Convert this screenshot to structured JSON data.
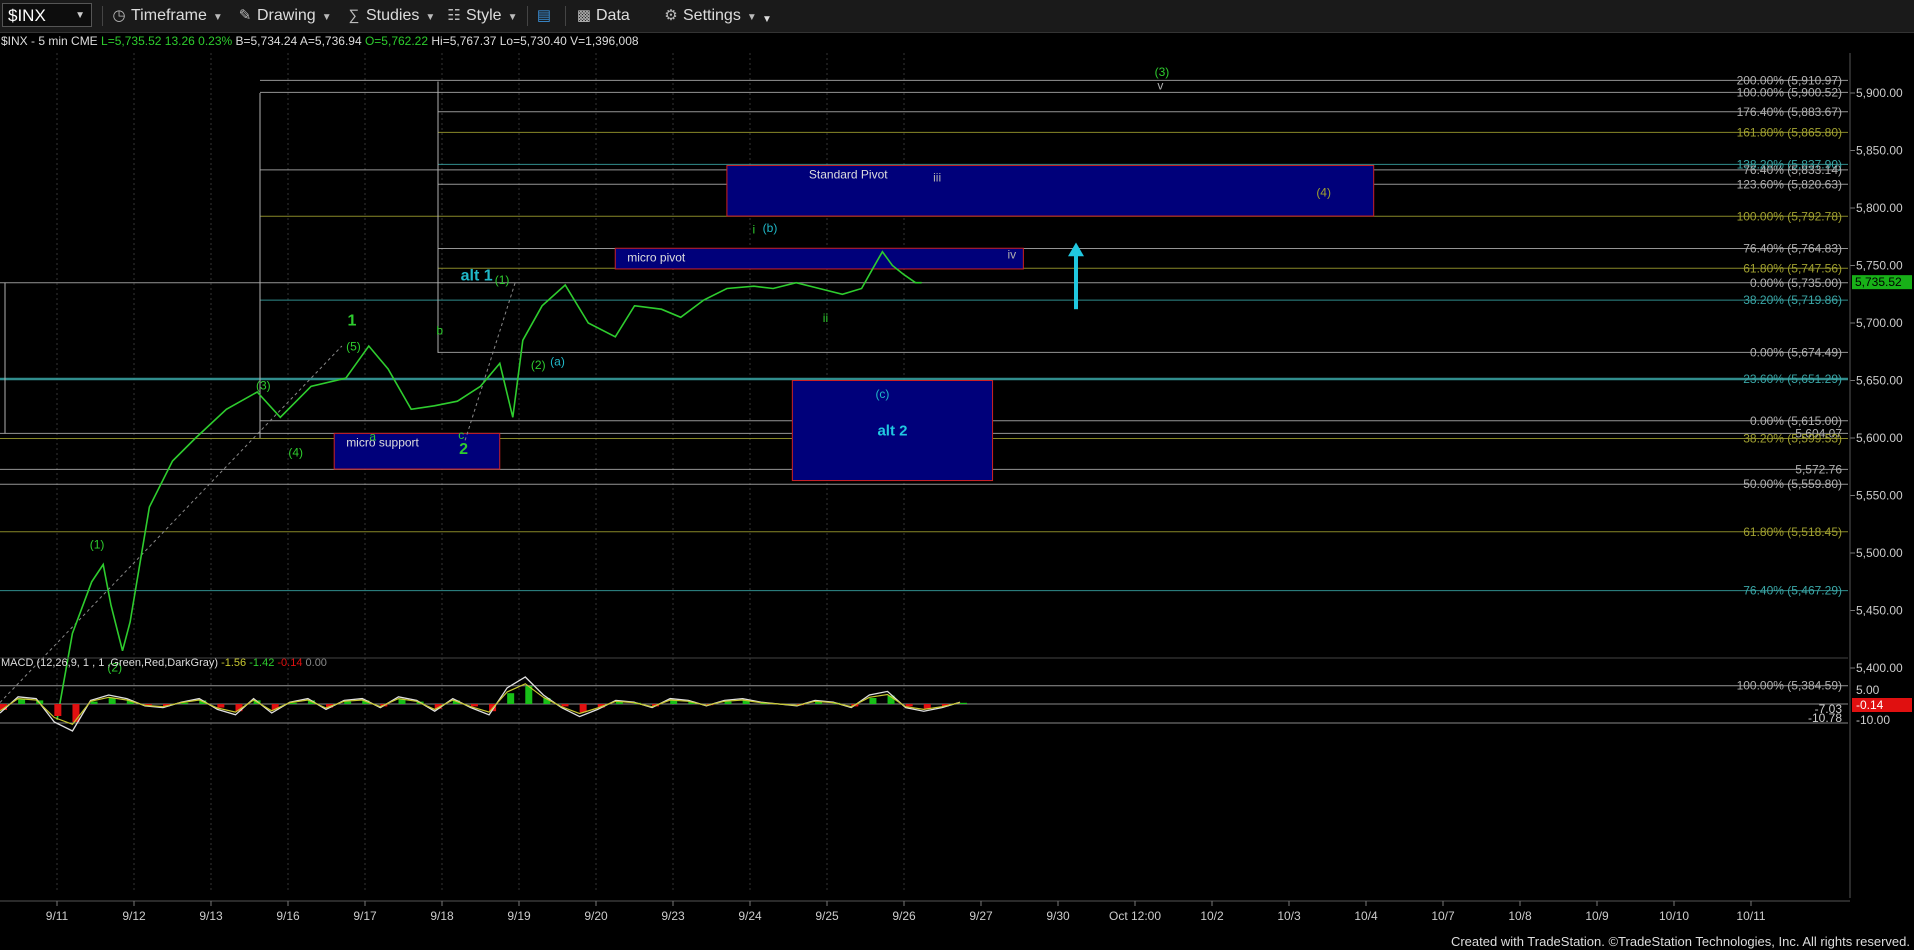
{
  "toolbar": {
    "symbol": "$INX",
    "timeframe": "Timeframe",
    "drawing": "Drawing",
    "studies": "Studies",
    "style": "Style",
    "data": "Data",
    "settings": "Settings"
  },
  "header": {
    "symbol": "$INX - 5 min",
    "exchange": "CME",
    "last": "L=5,735.52",
    "change": "13.26",
    "pct": "0.23%",
    "bid": "B=5,734.24",
    "ask": "A=5,736.94",
    "open": "O=5,762.22",
    "high": "Hi=5,767.37",
    "low": "Lo=5,730.40",
    "volume": "V=1,396,008"
  },
  "macd_header": {
    "name": "MACD (12,26,9, 1 , 1 ,Green,Red,DarkGray)",
    "v1": "-1.56",
    "v2": "-1.42",
    "v3": "-0.14",
    "v4": "0.00"
  },
  "footer": "Created with TradeStation. ©TradeStation Technologies, Inc. All rights reserved.",
  "colors": {
    "price": "#2ecc2e",
    "fib_white": "#b0b0b0",
    "fib_olive": "#a0a030",
    "fib_teal": "#3aa6a6",
    "box": "#00007a",
    "box_border": "#cc2222",
    "last_price": "#18b018",
    "macd_negative": "#e01010"
  },
  "chart_data": {
    "type": "line",
    "symbol": "$INX",
    "interval": "5 min",
    "ylim": [
      5350,
      5950
    ],
    "y_ticks": [
      "5,900.00",
      "5,850.00",
      "5,800.00",
      "5,750.00",
      "5,700.00",
      "5,650.00",
      "5,600.00",
      "5,550.00",
      "5,500.00",
      "5,450.00",
      "5,400.00"
    ],
    "x_ticks": [
      "9/11",
      "9/12",
      "9/13",
      "9/16",
      "9/17",
      "9/18",
      "9/19",
      "9/20",
      "9/23",
      "9/24",
      "9/25",
      "9/26",
      "9/27",
      "9/30",
      "Oct 12:00",
      "10/2",
      "10/3",
      "10/4",
      "10/7",
      "10/8",
      "10/9",
      "10/10",
      "10/11"
    ],
    "last_price": "5,735.52",
    "price_path": [
      [
        0,
        5355
      ],
      [
        0.2,
        5430
      ],
      [
        0.45,
        5475
      ],
      [
        0.6,
        5490
      ],
      [
        0.7,
        5455
      ],
      [
        0.85,
        5415
      ],
      [
        0.95,
        5440
      ],
      [
        1.2,
        5540
      ],
      [
        1.5,
        5580
      ],
      [
        1.8,
        5600
      ],
      [
        2.2,
        5625
      ],
      [
        2.6,
        5640
      ],
      [
        2.9,
        5618
      ],
      [
        3.3,
        5645
      ],
      [
        3.75,
        5652
      ],
      [
        4.05,
        5680
      ],
      [
        4.3,
        5660
      ],
      [
        4.6,
        5625
      ],
      [
        4.9,
        5628
      ],
      [
        5.2,
        5632
      ],
      [
        5.5,
        5645
      ],
      [
        5.75,
        5665
      ],
      [
        5.92,
        5618
      ],
      [
        6.05,
        5685
      ],
      [
        6.3,
        5715
      ],
      [
        6.6,
        5733
      ],
      [
        6.9,
        5700
      ],
      [
        7.25,
        5688
      ],
      [
        7.5,
        5715
      ],
      [
        7.85,
        5712
      ],
      [
        8.1,
        5705
      ],
      [
        8.4,
        5720
      ],
      [
        8.7,
        5730
      ],
      [
        9.05,
        5732
      ],
      [
        9.3,
        5730
      ],
      [
        9.6,
        5735
      ],
      [
        9.9,
        5730
      ],
      [
        10.2,
        5725
      ],
      [
        10.45,
        5730
      ],
      [
        10.6,
        5748
      ],
      [
        10.72,
        5762
      ],
      [
        10.85,
        5750
      ],
      [
        11.0,
        5742
      ],
      [
        11.15,
        5735
      ],
      [
        11.23,
        5735
      ]
    ],
    "macd": {
      "name": "MACD (12,26,9, 1 , 1 ,Green,Red,DarkGray)",
      "values": [
        "-1.56",
        "-1.42",
        "-0.14",
        "0.00"
      ],
      "axis_labels": [
        "5.00",
        "-0.14",
        "-7.03",
        "-10.00",
        "-10.78"
      ]
    },
    "fib_levels": [
      {
        "label": "200.00% (5,910.97)",
        "value": 5910.97,
        "color": "#b0b0b0"
      },
      {
        "label": "100.00% (5,900.52)",
        "value": 5900.52,
        "color": "#b0b0b0"
      },
      {
        "label": "176.40% (5,883.67)",
        "value": 5883.67,
        "color": "#b0b0b0"
      },
      {
        "label": "161.80% (5,865.80)",
        "value": 5865.8,
        "color": "#a0a030"
      },
      {
        "label": "138.20% (5,837.90)",
        "value": 5837.9,
        "color": "#3aa6a6"
      },
      {
        "label": "76.40% (5,833.14)",
        "value": 5833.14,
        "color": "#b0b0b0"
      },
      {
        "label": "123.60% (5,820.63)",
        "value": 5820.63,
        "color": "#b0b0b0"
      },
      {
        "label": "100.00% (5,792.78)",
        "value": 5792.78,
        "color": "#a0a030"
      },
      {
        "label": "76.40% (5,764.83)",
        "value": 5764.83,
        "color": "#b0b0b0"
      },
      {
        "label": "61.80% (5,747.56)",
        "value": 5747.56,
        "color": "#a0a030"
      },
      {
        "label": "0.00% (5,735.00)",
        "value": 5735.0,
        "color": "#b0b0b0"
      },
      {
        "label": "38.20% (5,719.86)",
        "value": 5719.86,
        "color": "#3aa6a6"
      },
      {
        "label": "0.00% (5,674.49)",
        "value": 5674.49,
        "color": "#b0b0b0"
      },
      {
        "label": "23.60% (5,651.29)",
        "value": 5651.29,
        "color": "#3aa6a6"
      },
      {
        "label": "0.00% (5,615.00)",
        "value": 5615.0,
        "color": "#b0b0b0"
      },
      {
        "label": "5,604.07",
        "value": 5604.07,
        "color": "#b0b0b0"
      },
      {
        "label": "38.20% (5,599.53)",
        "value": 5599.53,
        "color": "#a0a030"
      },
      {
        "label": "5,572.76",
        "value": 5572.76,
        "color": "#b0b0b0"
      },
      {
        "label": "50.00% (5,559.80)",
        "value": 5559.8,
        "color": "#b0b0b0"
      },
      {
        "label": "61.80% (5,518.45)",
        "value": 5518.45,
        "color": "#a0a030"
      },
      {
        "label": "76.40% (5,467.29)",
        "value": 5467.29,
        "color": "#3aa6a6"
      },
      {
        "label": "100.00% (5,384.59)",
        "value": 5384.59,
        "color": "#b0b0b0"
      }
    ],
    "boxes": [
      {
        "label": "Standard Pivot",
        "x0": 8.7,
        "x1": 17.1,
        "y0": 5793,
        "y1": 5837
      },
      {
        "label": "micro pivot",
        "x0": 7.25,
        "x1": 12.55,
        "y0": 5747,
        "y1": 5765
      },
      {
        "label": "micro support",
        "x0": 3.6,
        "x1": 5.75,
        "y0": 5573,
        "y1": 5604
      },
      {
        "label": "alt 2",
        "x0": 9.55,
        "x1": 12.15,
        "y0": 5563,
        "y1": 5650
      }
    ],
    "wave_labels": [
      {
        "text": "(1)",
        "x": 0.52,
        "y": 5504,
        "color": "#2ecc2e"
      },
      {
        "text": "(2)",
        "x": 0.75,
        "y": 5397,
        "color": "#2ecc2e"
      },
      {
        "text": "(3)",
        "x": 2.68,
        "y": 5642,
        "color": "#2ecc2e"
      },
      {
        "text": "(4)",
        "x": 3.1,
        "y": 5584,
        "color": "#2ecc2e"
      },
      {
        "text": "(5)",
        "x": 3.85,
        "y": 5676,
        "color": "#2ecc2e"
      },
      {
        "text": "1",
        "x": 3.83,
        "y": 5698,
        "color": "#2ecc2e"
      },
      {
        "text": "a",
        "x": 4.1,
        "y": 5598,
        "color": "#2ecc2e"
      },
      {
        "text": "b",
        "x": 4.97,
        "y": 5690,
        "color": "#2ecc2e"
      },
      {
        "text": "c",
        "x": 5.25,
        "y": 5599,
        "color": "#2ecc2e"
      },
      {
        "text": "2",
        "x": 5.28,
        "y": 5586,
        "color": "#2ecc2e"
      },
      {
        "text": "alt 1",
        "x": 5.45,
        "y": 5737,
        "color": "#20b8c8"
      },
      {
        "text": "(1)",
        "x": 5.78,
        "y": 5734,
        "color": "#2ecc2e"
      },
      {
        "text": "(2)",
        "x": 6.25,
        "y": 5660,
        "color": "#2ecc2e"
      },
      {
        "text": "(a)",
        "x": 6.5,
        "y": 5663,
        "color": "#20b8c8"
      },
      {
        "text": "i",
        "x": 9.05,
        "y": 5778,
        "color": "#2ecc2e"
      },
      {
        "text": "(b)",
        "x": 9.26,
        "y": 5779,
        "color": "#20b8c8"
      },
      {
        "text": "ii",
        "x": 9.98,
        "y": 5701,
        "color": "#2ecc2e"
      },
      {
        "text": "iii",
        "x": 11.43,
        "y": 5823,
        "color": "#b0b0b0"
      },
      {
        "text": "iv",
        "x": 12.4,
        "y": 5756,
        "color": "#b0b0b0"
      },
      {
        "text": "(c)",
        "x": 10.72,
        "y": 5635,
        "color": "#20b8c8"
      },
      {
        "text": "(3)",
        "x": 14.35,
        "y": 5915,
        "color": "#2ecc2e"
      },
      {
        "text": "v",
        "x": 14.33,
        "y": 5903,
        "color": "#b0b0b0"
      },
      {
        "text": "(4)",
        "x": 16.45,
        "y": 5810,
        "color": "#a0a030"
      }
    ]
  }
}
